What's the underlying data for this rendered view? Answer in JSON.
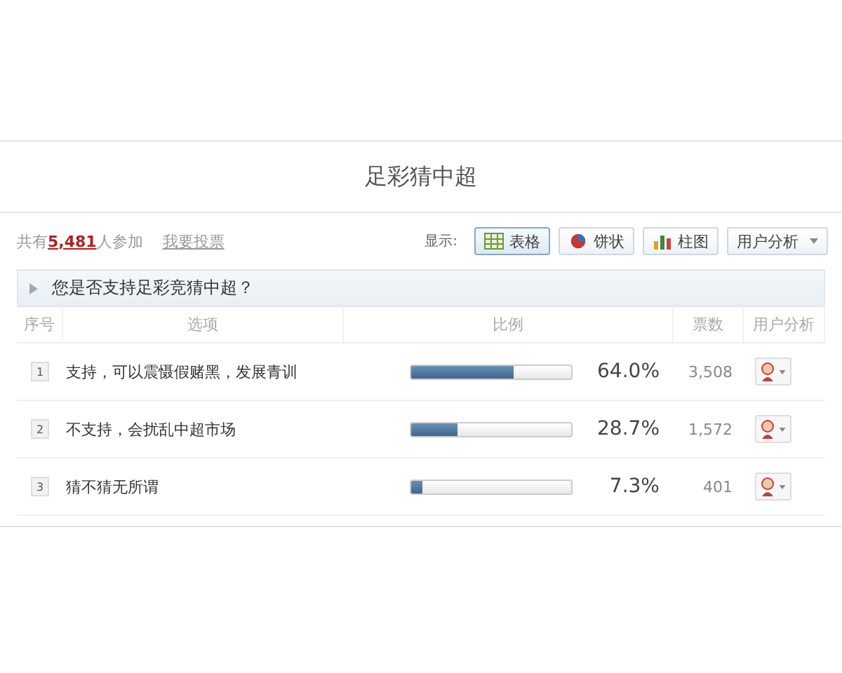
{
  "title": "足彩猜中超",
  "summary": {
    "prefix": "共有",
    "count": "5,481",
    "suffix": "人参加",
    "vote_link": "我要投票"
  },
  "display": {
    "label": "显示:",
    "views": [
      {
        "kind": "table",
        "label": "表格",
        "selected": true
      },
      {
        "kind": "pie",
        "label": "饼状",
        "selected": false
      },
      {
        "kind": "bar",
        "label": "柱图",
        "selected": false
      }
    ],
    "analysis_dropdown": "用户分析"
  },
  "question": "您是否支持足彩竞猜中超？",
  "table": {
    "columns": [
      "序号",
      "选项",
      "比例",
      "票数",
      "用户分析"
    ],
    "rows": [
      {
        "index": "1",
        "option": "支持，可以震慑假赌黑，发展青训",
        "level": 0.64,
        "percent": "64.0%",
        "votes": "3,508"
      },
      {
        "index": "2",
        "option": "不支持，会扰乱中超市场",
        "level": 0.287,
        "percent": "28.7%",
        "votes": "1,572"
      },
      {
        "index": "3",
        "option": "猜不猜无所谓",
        "level": 0.073,
        "percent": "7.3%",
        "votes": "401"
      }
    ]
  }
}
